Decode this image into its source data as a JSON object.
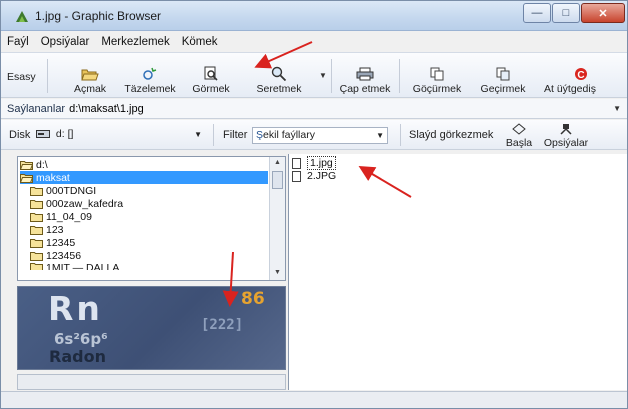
{
  "window": {
    "title": "1.jpg - Graphic Browser",
    "app_icon": "graphic-browser-icon",
    "controls": {
      "minimize": "—",
      "maximize": "□",
      "close": "✕"
    }
  },
  "menu": {
    "items": [
      "Faýl",
      "Opsiýalar",
      "Merkezlemek",
      "Kömek"
    ]
  },
  "toolbar": {
    "esasy_label": "Esasy",
    "buttons": [
      {
        "label": "Açmak",
        "icon": "open-folder-icon"
      },
      {
        "label": "Täzelemek",
        "icon": "refresh-icon"
      },
      {
        "label": "Görmek",
        "icon": "view-icon"
      },
      {
        "label": "Seretmek",
        "icon": "magnifier-icon"
      },
      {
        "label": "Çap etmek",
        "icon": "printer-icon"
      },
      {
        "label": "Göçürmek",
        "icon": "copy-icon"
      },
      {
        "label": "Geçirmek",
        "icon": "move-icon"
      },
      {
        "label": "At üýtgediş",
        "icon": "rename-icon"
      }
    ]
  },
  "path": {
    "label": "Saýlananlar",
    "value": "d:\\maksat\\1.jpg"
  },
  "filterbar": {
    "disk_label": "Disk",
    "disk_value": "d: []",
    "filter_label": "Filter",
    "filter_value_prefix": "Ş",
    "filter_value_rest": "ekil faýllary",
    "slide_label": "Slaýd görkezmek",
    "start_label": "Başla",
    "options_label": "Opsiýalar"
  },
  "tree": {
    "items": [
      {
        "label": "d:\\",
        "open": true,
        "selected": false
      },
      {
        "label": "maksat",
        "open": true,
        "selected": true
      },
      {
        "label": "000TDNGI",
        "open": false,
        "selected": false
      },
      {
        "label": "000zaw_kafedra",
        "open": false,
        "selected": false
      },
      {
        "label": "11_04_09",
        "open": false,
        "selected": false
      },
      {
        "label": "123",
        "open": false,
        "selected": false
      },
      {
        "label": "12345",
        "open": false,
        "selected": false
      },
      {
        "label": "123456",
        "open": false,
        "selected": false
      },
      {
        "label": "1MIT — DALLA",
        "open": false,
        "selected": false
      }
    ]
  },
  "preview": {
    "symbol": "Rn",
    "atomic_number": "86",
    "mass": "[222]",
    "configuration": "6s²6p⁶",
    "name": "Radon"
  },
  "files": [
    {
      "name": "1.jpg",
      "selected": true
    },
    {
      "name": "2.JPG",
      "selected": false
    }
  ],
  "colors": {
    "selection": "#3399ff",
    "annotation_arrow": "#d9231f"
  }
}
